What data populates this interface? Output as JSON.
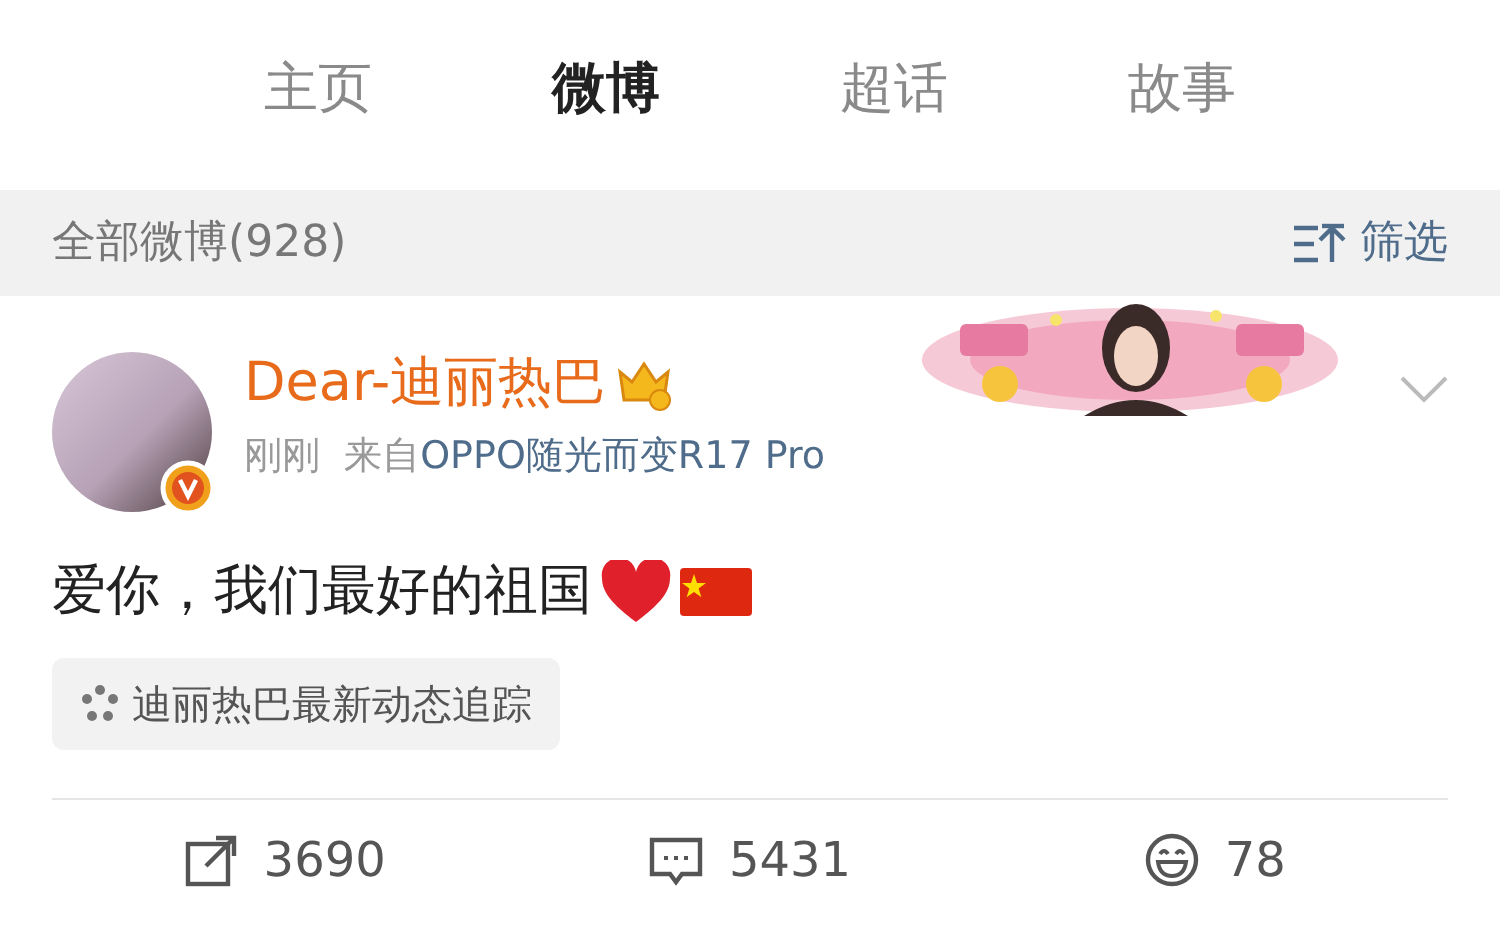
{
  "tabs": [
    {
      "label": "主页",
      "selected": false
    },
    {
      "label": "微博",
      "selected": true
    },
    {
      "label": "超话",
      "selected": false
    },
    {
      "label": "故事",
      "selected": false
    }
  ],
  "feed_header": {
    "title": "全部微博(928)",
    "filter": "筛选"
  },
  "post": {
    "author": "Dear-迪丽热巴",
    "verified": true,
    "time": "刚刚",
    "source_label": "来自",
    "source": "OPPO随光而变R17 Pro",
    "text": "爱你，我们最好的祖国",
    "topic": "迪丽热巴最新动态追踪",
    "actions": [
      {
        "kind": "share",
        "count": "3690"
      },
      {
        "kind": "comment",
        "count": "5431"
      },
      {
        "kind": "like",
        "count": "78"
      }
    ]
  }
}
